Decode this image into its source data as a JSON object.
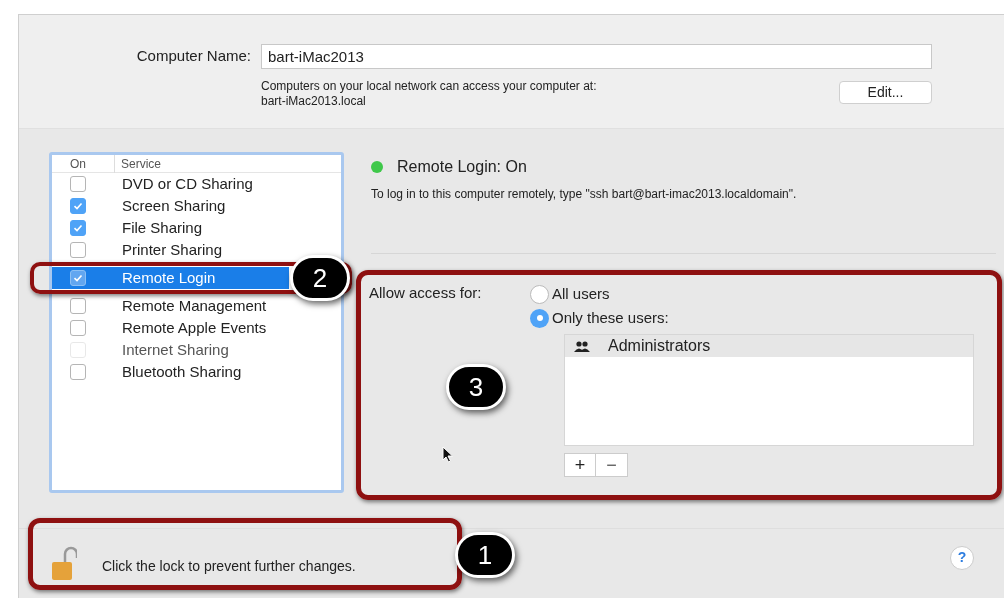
{
  "computer_name": {
    "label": "Computer Name:",
    "value": "bart-iMac2013",
    "note": "Computers on your local network can access your computer at:",
    "address": "bart-iMac2013.local",
    "edit_button": "Edit..."
  },
  "services": {
    "columns": [
      "On",
      "Service"
    ],
    "rows": [
      {
        "name": "DVD or CD Sharing",
        "checked": false,
        "selected": false,
        "disabled": false
      },
      {
        "name": "Screen Sharing",
        "checked": true,
        "selected": false,
        "disabled": false
      },
      {
        "name": "File Sharing",
        "checked": true,
        "selected": false,
        "disabled": false
      },
      {
        "name": "Printer Sharing",
        "checked": false,
        "selected": false,
        "disabled": false
      },
      {
        "name": "Remote Login",
        "checked": true,
        "selected": true,
        "disabled": false
      },
      {
        "name": "Remote Management",
        "checked": false,
        "selected": false,
        "disabled": false
      },
      {
        "name": "Remote Apple Events",
        "checked": false,
        "selected": false,
        "disabled": false
      },
      {
        "name": "Internet Sharing",
        "checked": false,
        "selected": false,
        "disabled": true
      },
      {
        "name": "Bluetooth Sharing",
        "checked": false,
        "selected": false,
        "disabled": false
      }
    ]
  },
  "status": {
    "title": "Remote Login: On",
    "color": "#3fc84a",
    "description": "To log in to this computer remotely, type \"ssh bart@bart-imac2013.localdomain\"."
  },
  "access": {
    "label": "Allow access for:",
    "options": [
      {
        "label": "All users",
        "selected": false
      },
      {
        "label": "Only these users:",
        "selected": true
      }
    ],
    "users": [
      "Administrators"
    ],
    "add_button": "+",
    "remove_button": "−"
  },
  "lock": {
    "text": "Click the lock to prevent further changes.",
    "locked": false
  },
  "help_button": "?",
  "annotations": [
    "1",
    "2",
    "3"
  ]
}
